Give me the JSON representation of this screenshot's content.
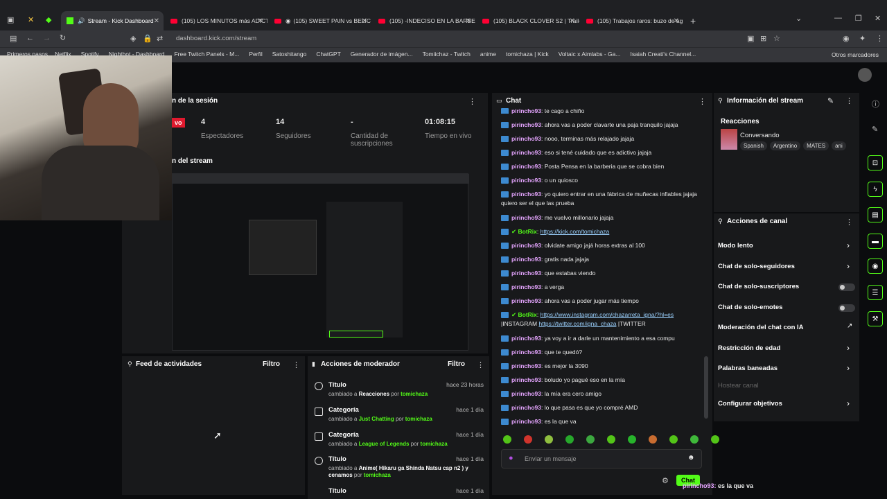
{
  "browser": {
    "tabs": [
      {
        "title": "Stream - Kick Dashboard"
      },
      {
        "title": "(105) LOS MINUTOS más ADICT"
      },
      {
        "title": "(105) SWEET PAIN vs BELIC"
      },
      {
        "title": "(105) -INDECISO EN LA BARBER"
      },
      {
        "title": "(105) BLACK CLOVER S2 | Trailer"
      },
      {
        "title": "(105) Trabajos raros: buzo de ag"
      }
    ],
    "url": "dashboard.kick.com/stream",
    "bookmarks": [
      "Primeros pasos",
      "Netflix",
      "Spotify",
      "Nightbot - Dashboard",
      "Free Twitch Panels - M...",
      "Perfil",
      "Satoshitango",
      "ChatGPT",
      "Generador de imágen...",
      "Tomiichaz - Twitch",
      "anime",
      "tomichaza | Kick",
      "Voltaic x Aimlabs - Ga...",
      "Isaiah Creati's Channel..."
    ],
    "other_bookmarks": "Otros marcadores"
  },
  "session": {
    "title": "n de la sesión",
    "badge": "vo",
    "stats": [
      {
        "value": "4",
        "label": "Espectadores"
      },
      {
        "value": "14",
        "label": "Seguidores"
      },
      {
        "value": "-",
        "label": "Cantidad de suscripciones"
      },
      {
        "value": "01:08:15",
        "label": "Tiempo en vivo"
      }
    ],
    "preview_title": "n del stream"
  },
  "activity": {
    "title": "Feed de actividades",
    "filter": "Filtro"
  },
  "mod_actions": {
    "title": "Acciones de moderador",
    "filter": "Filtro",
    "items": [
      {
        "title": "Título",
        "prefix": "cambiado a",
        "value": "Reacciones",
        "by": "por",
        "user": "tomichaza",
        "time": "hace 23 horas"
      },
      {
        "title": "Categoría",
        "prefix": "cambiado a",
        "value": "Just Chatting",
        "by": "por",
        "user": "tomichaza",
        "time": "hace 1 día"
      },
      {
        "title": "Categoría",
        "prefix": "cambiado a",
        "value": "League of Legends",
        "by": "por",
        "user": "tomichaza",
        "time": "hace 1 día"
      },
      {
        "title": "Título",
        "prefix": "cambiado a",
        "value": "Anime( Hikaru ga Shinda Natsu cap n2 ) y cenamos",
        "by": "por",
        "user": "tomichaza",
        "time": "hace 1 día"
      },
      {
        "title": "Título",
        "time": "hace 1 día"
      }
    ]
  },
  "chat": {
    "title": "Chat",
    "messages": [
      {
        "user": "pirincho93",
        "text": "te cago a chiño"
      },
      {
        "user": "pirincho93",
        "text": "ahora vas a poder clavarte una paja tranquilo jajaja"
      },
      {
        "user": "pirincho93",
        "text": "nooo, terminas más relajado jajaja"
      },
      {
        "user": "pirincho93",
        "text": "eso si tené cuidado que es adictivo jajaja"
      },
      {
        "user": "pirincho93",
        "text": "Posta Pensa en la barberia que se cobra bien"
      },
      {
        "user": "pirincho93",
        "text": "o un quiosco"
      },
      {
        "user": "pirincho93",
        "text": "yo quiero entrar en una fábrica de muñecas inflables jajaja quiero ser el que las prueba"
      },
      {
        "user": "pirincho93",
        "text": "me vuelvo millonario jajaja"
      },
      {
        "user": "BotRix",
        "link": "https://kick.com/tomichaza"
      },
      {
        "user": "pirincho93",
        "text": "olvidate amigo jajá horas extras al 100"
      },
      {
        "user": "pirincho93",
        "text": "gratis nada jajaja"
      },
      {
        "user": "pirincho93",
        "text": "que estabas viendo"
      },
      {
        "user": "pirincho93",
        "text": "a verga"
      },
      {
        "user": "pirincho93",
        "text": "ahora vas a poder jugar más tiempo"
      },
      {
        "user": "BotRix",
        "link": "https://www.instagram.com/chazarreta_igna/?hl=es",
        "text2": "|INSTAGRAM",
        "link2": "https://twitter.com/igna_chaza",
        "text3": "|TWITTER"
      },
      {
        "user": "pirincho93",
        "text": "ya voy a ir a darle un mantenimiento a esa compu"
      },
      {
        "user": "pirincho93",
        "text": "que te quedó?"
      },
      {
        "user": "pirincho93",
        "text": "es mejor la 3090"
      },
      {
        "user": "pirincho93",
        "text": "boludo yo pagué eso en la mía"
      },
      {
        "user": "pirincho93",
        "text": "la mía era cero amigo"
      },
      {
        "user": "pirincho93",
        "text": "lo que pasa es que yo compré AMD"
      },
      {
        "user": "pirincho93",
        "text": "es la que va"
      }
    ],
    "input_placeholder": "Enviar un mensaje",
    "send_label": "Chat",
    "overlay": {
      "user": "pirincho93:",
      "text": "es la que va"
    }
  },
  "stream_info": {
    "title": "Información del stream",
    "reactions_label": "Reacciones",
    "category": "Conversando",
    "tags": [
      "Spanish",
      "Argentino",
      "MATES",
      "ani"
    ]
  },
  "channel_actions": {
    "title": "Acciones de canal",
    "items": [
      {
        "label": "Modo lento",
        "control": "arrow"
      },
      {
        "label": "Chat de solo-seguidores",
        "control": "arrow"
      },
      {
        "label": "Chat de solo-suscriptores",
        "control": "toggle"
      },
      {
        "label": "Chat de solo-emotes",
        "control": "toggle"
      },
      {
        "label": "Moderación del chat con IA",
        "control": "link"
      },
      {
        "label": "Restricción de edad",
        "control": "arrow"
      },
      {
        "label": "Palabras baneadas",
        "control": "arrow"
      },
      {
        "label": "Hostear canal",
        "control": "disabled"
      },
      {
        "label": "Configurar objetivos",
        "control": "arrow"
      }
    ]
  }
}
